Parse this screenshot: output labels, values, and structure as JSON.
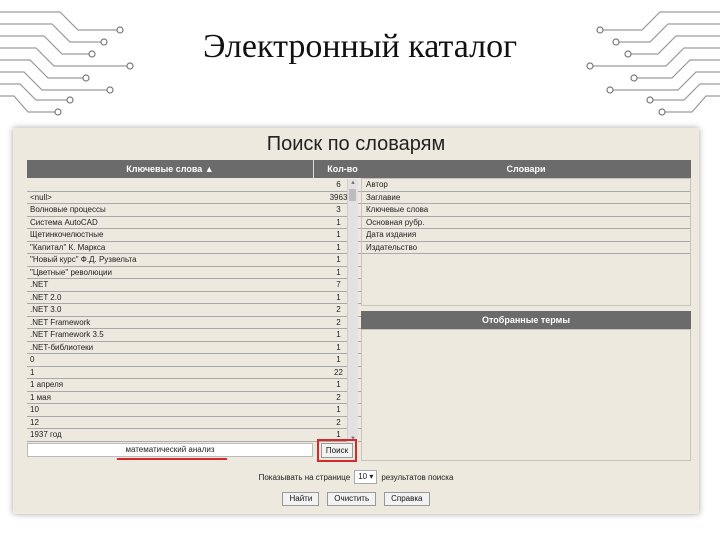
{
  "slide": {
    "title": "Электронный каталог"
  },
  "page": {
    "title": "Поиск по словарям",
    "keywords": {
      "header_keyword": "Ключевые слова ▲",
      "header_count": "Кол-во",
      "rows": [
        {
          "kw": "",
          "count": "6"
        },
        {
          "kw": "<null>",
          "count": "3963"
        },
        {
          "kw": "Волновые процессы",
          "count": "3"
        },
        {
          "kw": "Система AutoCAD",
          "count": "1"
        },
        {
          "kw": "Щетинкочелюстные",
          "count": "1"
        },
        {
          "kw": "\"Капитал\" К. Маркса",
          "count": "1"
        },
        {
          "kw": "\"Новый курс\" Ф.Д. Рузвельта",
          "count": "1"
        },
        {
          "kw": "\"Цветные\" революции",
          "count": "1"
        },
        {
          "kw": ".NET",
          "count": "7"
        },
        {
          "kw": ".NET 2.0",
          "count": "1"
        },
        {
          "kw": ".NET 3.0",
          "count": "2"
        },
        {
          "kw": ".NET Framework",
          "count": "2"
        },
        {
          "kw": ".NET Framework 3.5",
          "count": "1"
        },
        {
          "kw": ".NET-библиотеки",
          "count": "1"
        },
        {
          "kw": "0",
          "count": "1"
        },
        {
          "kw": "1",
          "count": "22"
        },
        {
          "kw": "1 апреля",
          "count": "1"
        },
        {
          "kw": "1 мая",
          "count": "2"
        },
        {
          "kw": "10",
          "count": "1"
        },
        {
          "kw": "12",
          "count": "2"
        },
        {
          "kw": "1937 год",
          "count": "1"
        }
      ]
    },
    "query_value": "математический анализ",
    "search_button": "Поиск",
    "dictionaries": {
      "header": "Словари",
      "items": [
        "Автор",
        "Заглавие",
        "Ключевые слова",
        "Основная рубр.",
        "Дата издания",
        "Издательство"
      ]
    },
    "selected_terms": {
      "header": "Отобранные термы"
    },
    "pager": {
      "prefix": "Показывать на странице",
      "value": "10 ▾",
      "suffix": "результатов поиска"
    },
    "actions": {
      "find": "Найти",
      "clear": "Очистить",
      "help": "Справка"
    },
    "colors": {
      "panel_bg": "#ede9df",
      "header_bg": "#6b6b6b",
      "highlight": "#d42a2a"
    }
  }
}
